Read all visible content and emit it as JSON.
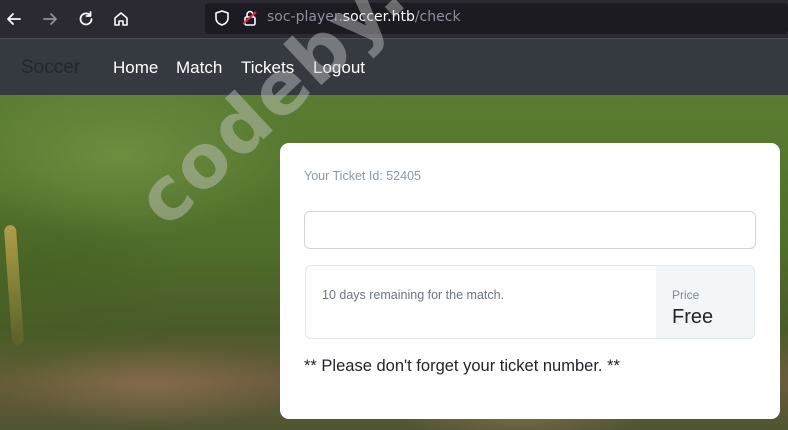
{
  "browser": {
    "url_prefix": "soc-player.",
    "url_host": "soccer.htb",
    "url_path": "/check",
    "icons": [
      "back-icon",
      "forward-icon",
      "reload-icon",
      "home-icon",
      "shield-icon",
      "lock-warning-icon"
    ]
  },
  "site_nav": {
    "brand": "Soccer",
    "links": [
      "Home",
      "Match",
      "Tickets",
      "Logout"
    ]
  },
  "card": {
    "ticket_id_text": "Your Ticket Id: 52405",
    "ticket_input_value": "",
    "remaining_text": "10 days remaining for the match.",
    "price_label": "Price",
    "price_value": "Free",
    "note": "** Please don't forget your ticket number. **"
  },
  "watermark": "codeby.net",
  "colors": {
    "toolbar_bg": "#2b2a33",
    "nav_bg": "#343a40",
    "card_bg": "#ffffff",
    "lock_warning": "#e22850"
  }
}
